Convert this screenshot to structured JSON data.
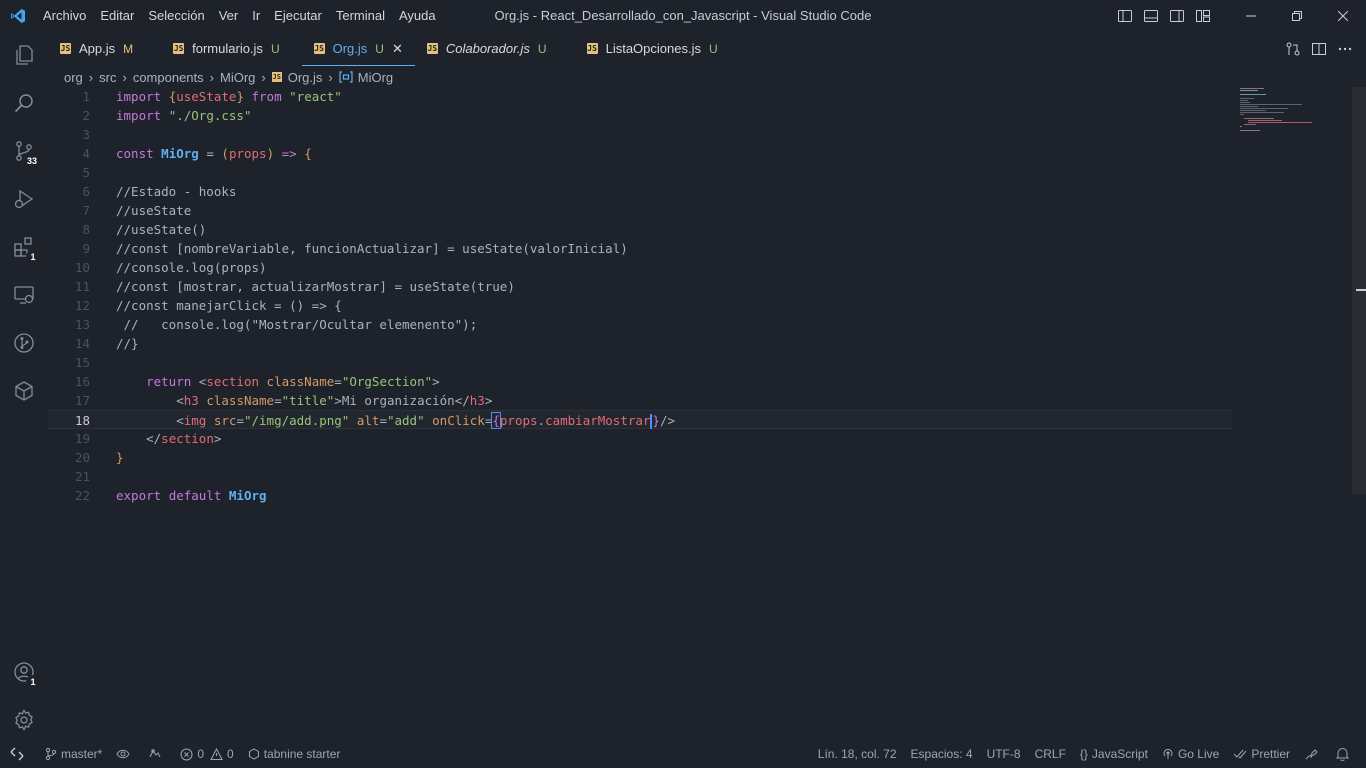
{
  "titlebar": {
    "menu": [
      "Archivo",
      "Editar",
      "Selección",
      "Ver",
      "Ir",
      "Ejecutar",
      "Terminal",
      "Ayuda"
    ],
    "window_title": "Org.js - React_Desarrollado_con_Javascript - Visual Studio Code"
  },
  "activitybar": {
    "source_control_badge": "33",
    "extensions_badge": "1",
    "accounts_badge": "1"
  },
  "tabs": [
    {
      "name": "App.js",
      "status": "M",
      "active": false,
      "italic": false
    },
    {
      "name": "formulario.js",
      "status": "U",
      "active": false,
      "italic": false
    },
    {
      "name": "Org.js",
      "status": "U",
      "active": true,
      "italic": false
    },
    {
      "name": "Colaborador.js",
      "status": "U",
      "active": false,
      "italic": true
    },
    {
      "name": "ListaOpciones.js",
      "status": "U",
      "active": false,
      "italic": false
    }
  ],
  "file_icon_label": "JS",
  "close_glyph": "✕",
  "breadcrumb": {
    "parts": [
      "org",
      "src",
      "components",
      "MiOrg",
      "Org.js",
      "MiOrg"
    ]
  },
  "editor": {
    "current_line": 18,
    "line_numbers": [
      "1",
      "2",
      "3",
      "4",
      "5",
      "6",
      "7",
      "8",
      "9",
      "10",
      "11",
      "12",
      "13",
      "14",
      "15",
      "16",
      "17",
      "18",
      "19",
      "20",
      "21",
      "22"
    ]
  },
  "statusbar": {
    "branch": "master*",
    "errors": "0",
    "warnings": "0",
    "tabnine": "tabnine starter",
    "position": "Lín. 18, col. 72",
    "spaces": "Espacios: 4",
    "encoding": "UTF-8",
    "eol": "CRLF",
    "language": "JavaScript",
    "golive": "Go Live",
    "prettier": "Prettier"
  }
}
